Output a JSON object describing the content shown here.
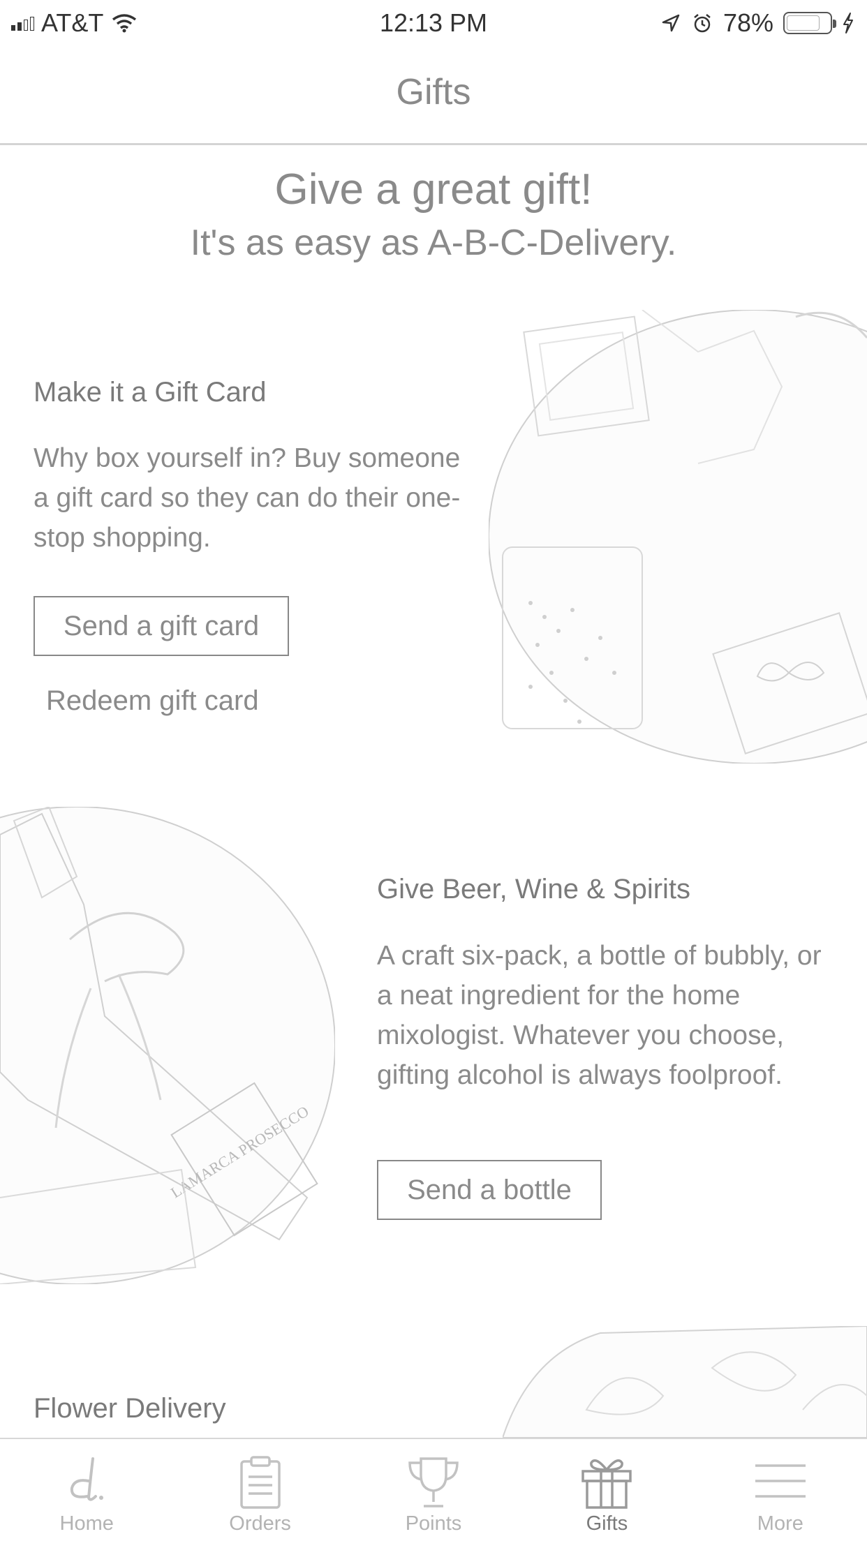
{
  "status_bar": {
    "carrier": "AT&T",
    "time": "12:13 PM",
    "battery": "78%",
    "battery_level": 0.78,
    "icons": [
      "signal-icon",
      "wifi-icon",
      "location-icon",
      "alarm-icon",
      "battery-icon",
      "charging-icon"
    ]
  },
  "nav": {
    "title": "Gifts"
  },
  "hero": {
    "title": "Give a great gift!",
    "subtitle": "It's as easy as A-B-C-Delivery."
  },
  "gift_card": {
    "heading": "Make it a Gift Card",
    "body": "Why box yourself in? Buy someone a gift card so they can do their one-stop shopping.",
    "button": "Send a gift card",
    "link": "Redeem gift card"
  },
  "alcohol": {
    "heading": "Give Beer, Wine & Spirits",
    "body": "A craft six-pack, a bottle of bubbly, or a neat ingredient for the home mixologist. Whatever you choose, gifting alcohol is always foolproof.",
    "button": "Send a bottle",
    "label_text": "LAMARCA PROSECCO"
  },
  "flowers": {
    "heading": "Flower Delivery"
  },
  "tabs": [
    {
      "label": "Home",
      "icon": "home-logo-icon",
      "active": false
    },
    {
      "label": "Orders",
      "icon": "clipboard-icon",
      "active": false
    },
    {
      "label": "Points",
      "icon": "trophy-icon",
      "active": false
    },
    {
      "label": "Gifts",
      "icon": "gift-icon",
      "active": true
    },
    {
      "label": "More",
      "icon": "menu-icon",
      "active": false
    }
  ]
}
